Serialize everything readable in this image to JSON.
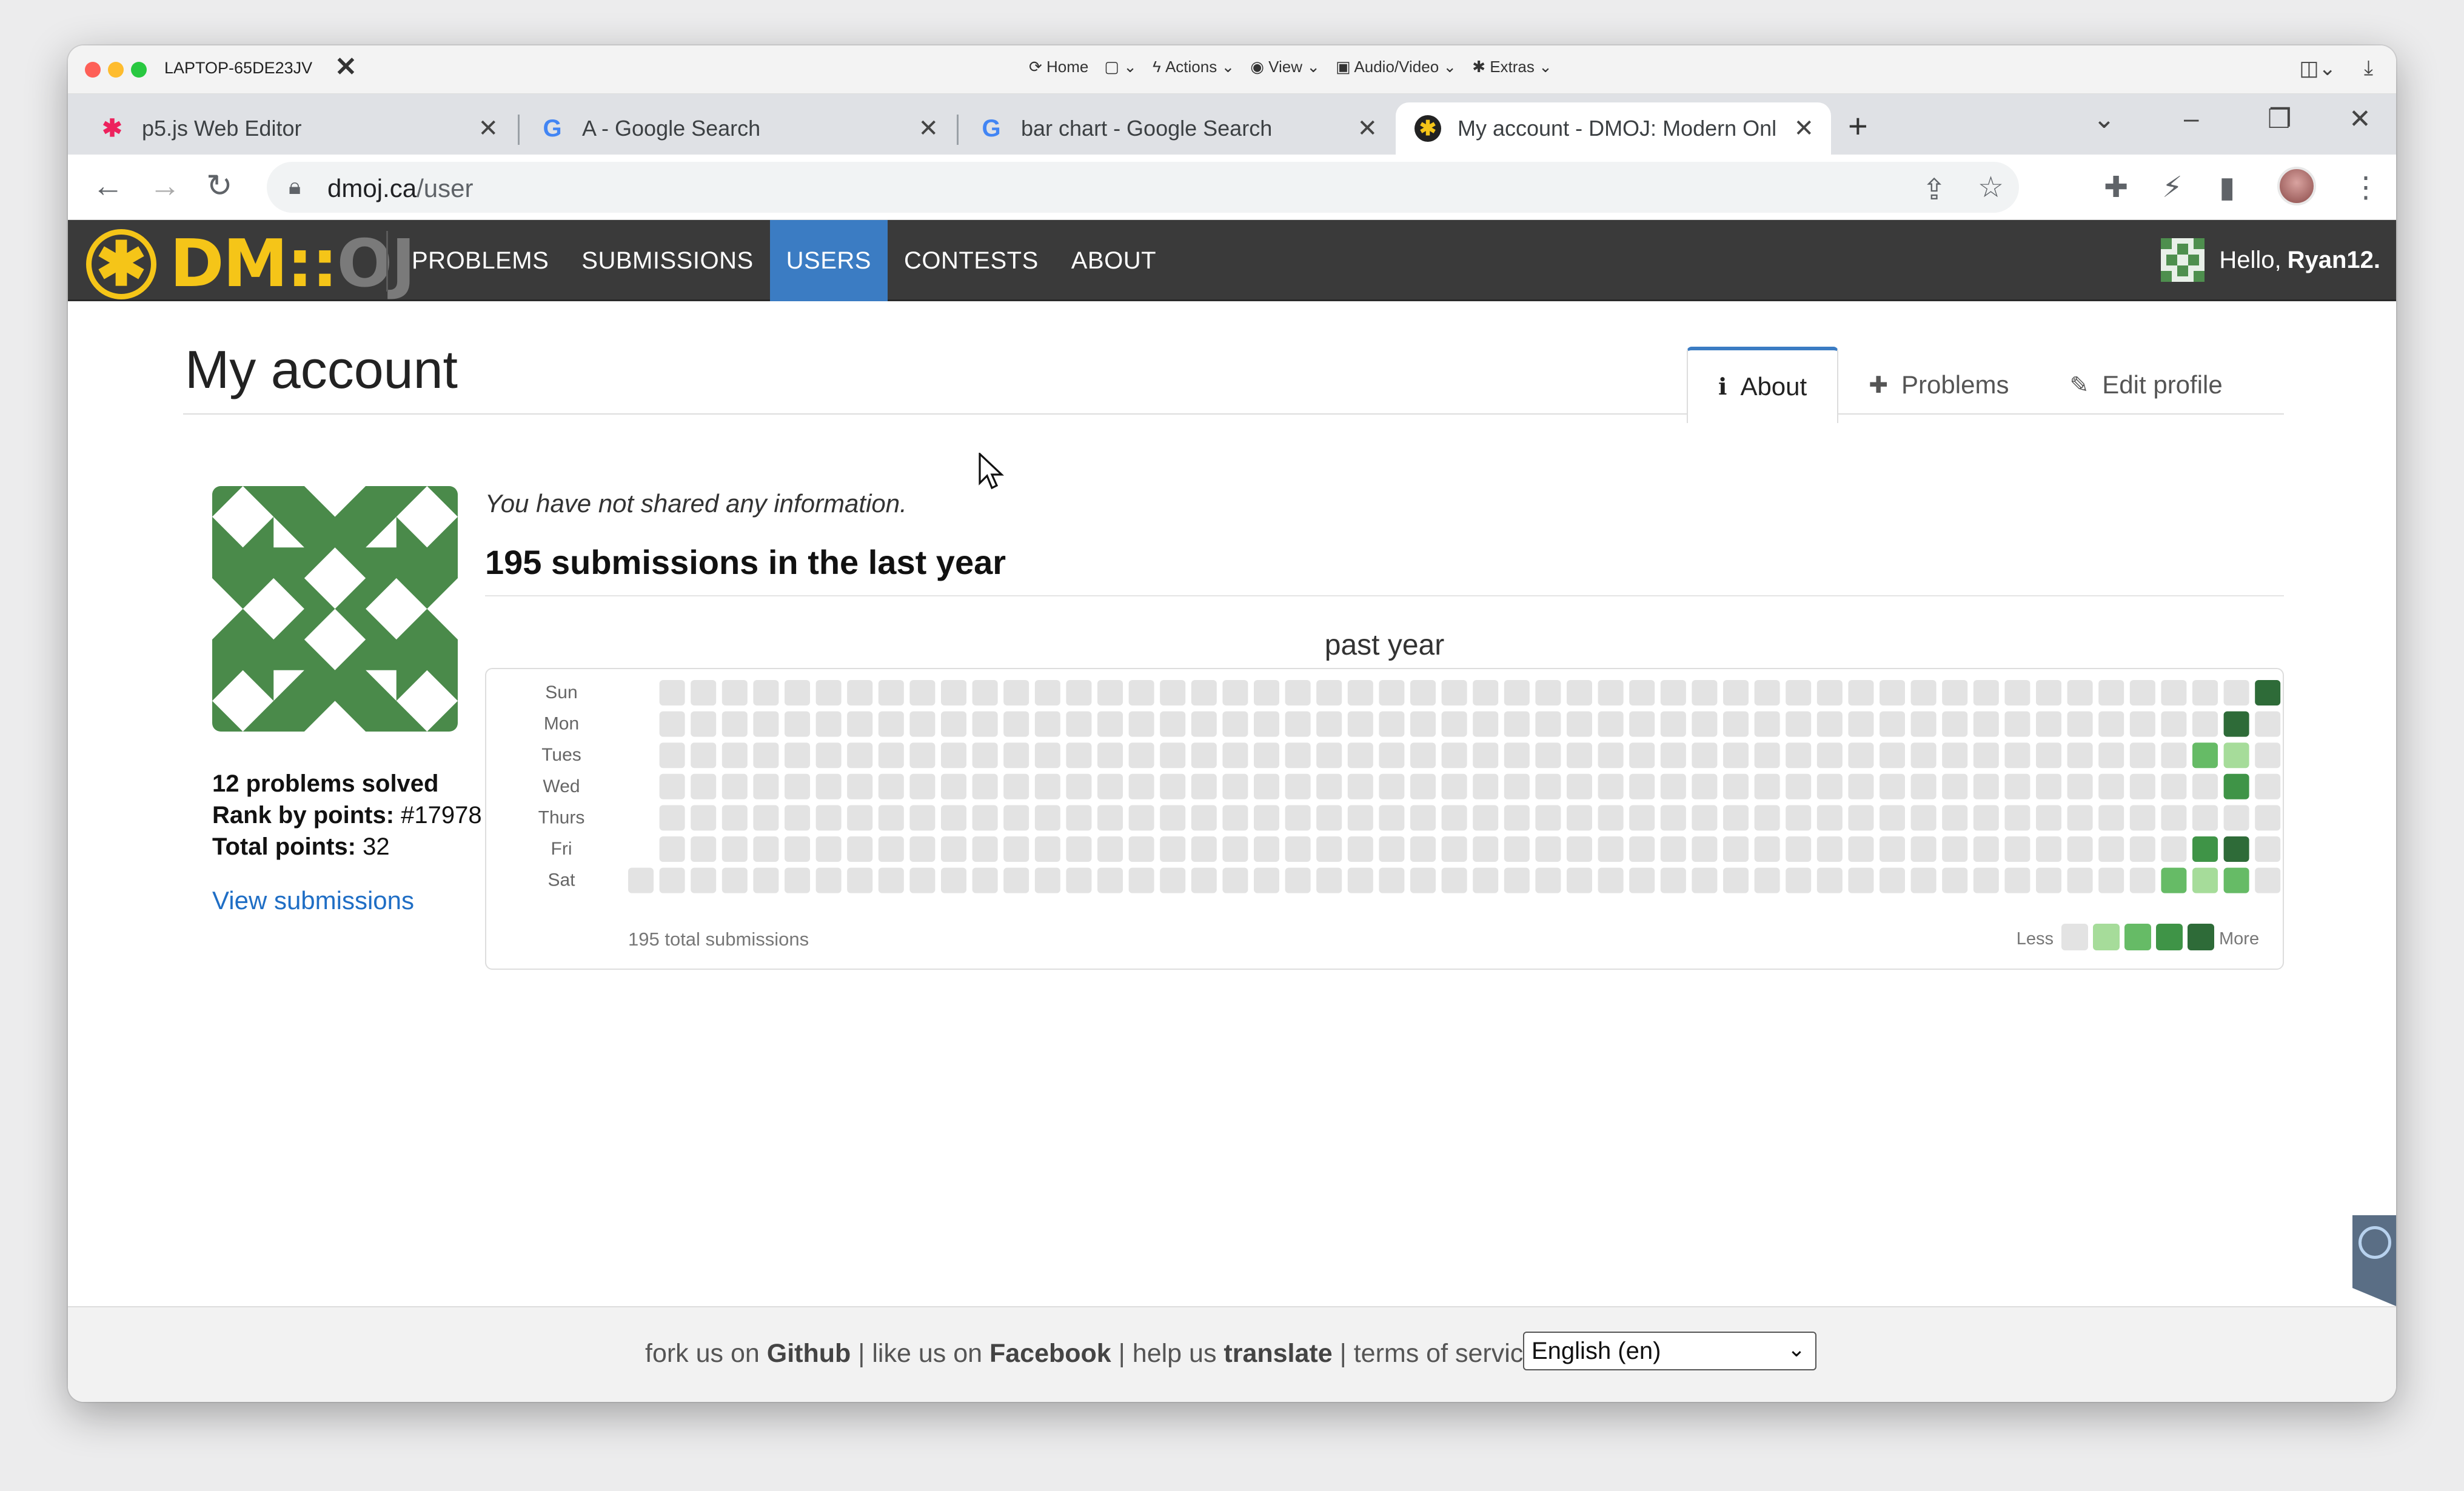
{
  "remote_bar": {
    "host": "LAPTOP-65DE23JV",
    "menu": [
      "Home",
      "Actions",
      "View",
      "Audio/Video",
      "Extras"
    ]
  },
  "tabs": [
    {
      "title": "p5.js Web Editor",
      "active": false
    },
    {
      "title": "A - Google Search",
      "active": false
    },
    {
      "title": "bar chart - Google Search",
      "active": false
    },
    {
      "title": "My account - DMOJ: Modern Onl",
      "active": true
    }
  ],
  "address": {
    "domain": "dmoj.ca",
    "path": "/user"
  },
  "site": {
    "logo": "DM::OJ",
    "nav": [
      "PROBLEMS",
      "SUBMISSIONS",
      "USERS",
      "CONTESTS",
      "ABOUT"
    ],
    "nav_active": "USERS",
    "hello_prefix": "Hello,",
    "username": "Ryan12."
  },
  "page": {
    "title": "My account",
    "tabs": [
      {
        "label": "About",
        "icon": "info-icon",
        "active": true
      },
      {
        "label": "Problems",
        "icon": "puzzle-icon",
        "active": false
      },
      {
        "label": "Edit profile",
        "icon": "edit-icon",
        "active": false
      }
    ],
    "problems_solved": "12 problems solved",
    "rank_label": "Rank by points:",
    "rank_value": "#17978",
    "points_label": "Total points:",
    "points_value": "32",
    "view_submissions": "View submissions",
    "no_info": "You have not shared any information.",
    "submissions_heading": "195 submissions in the last year"
  },
  "calendar": {
    "title": "past year",
    "days": [
      "Sun",
      "Mon",
      "Tues",
      "Wed",
      "Thurs",
      "Fri",
      "Sat"
    ],
    "total_label": "195 total submissions",
    "less": "Less",
    "more": "More",
    "colors": [
      "#e3e3e3",
      "#a6dc9a",
      "#66bb66",
      "#3f9447",
      "#2e6b38"
    ],
    "weeks": 53,
    "active_cells": [
      {
        "week": 52,
        "day": 0,
        "level": 4
      },
      {
        "week": 51,
        "day": 1,
        "level": 4
      },
      {
        "week": 50,
        "day": 2,
        "level": 2
      },
      {
        "week": 51,
        "day": 2,
        "level": 1
      },
      {
        "week": 51,
        "day": 3,
        "level": 3
      },
      {
        "week": 50,
        "day": 5,
        "level": 3
      },
      {
        "week": 51,
        "day": 5,
        "level": 4
      },
      {
        "week": 49,
        "day": 6,
        "level": 2
      },
      {
        "week": 50,
        "day": 6,
        "level": 1
      },
      {
        "week": 51,
        "day": 6,
        "level": 2
      }
    ]
  },
  "footer": {
    "fork": "fork us on",
    "github": "Github",
    "like": "| like us on",
    "facebook": "Facebook",
    "help": "| help us",
    "translate": "translate",
    "terms": "| terms of service |",
    "language": "English (en)"
  }
}
